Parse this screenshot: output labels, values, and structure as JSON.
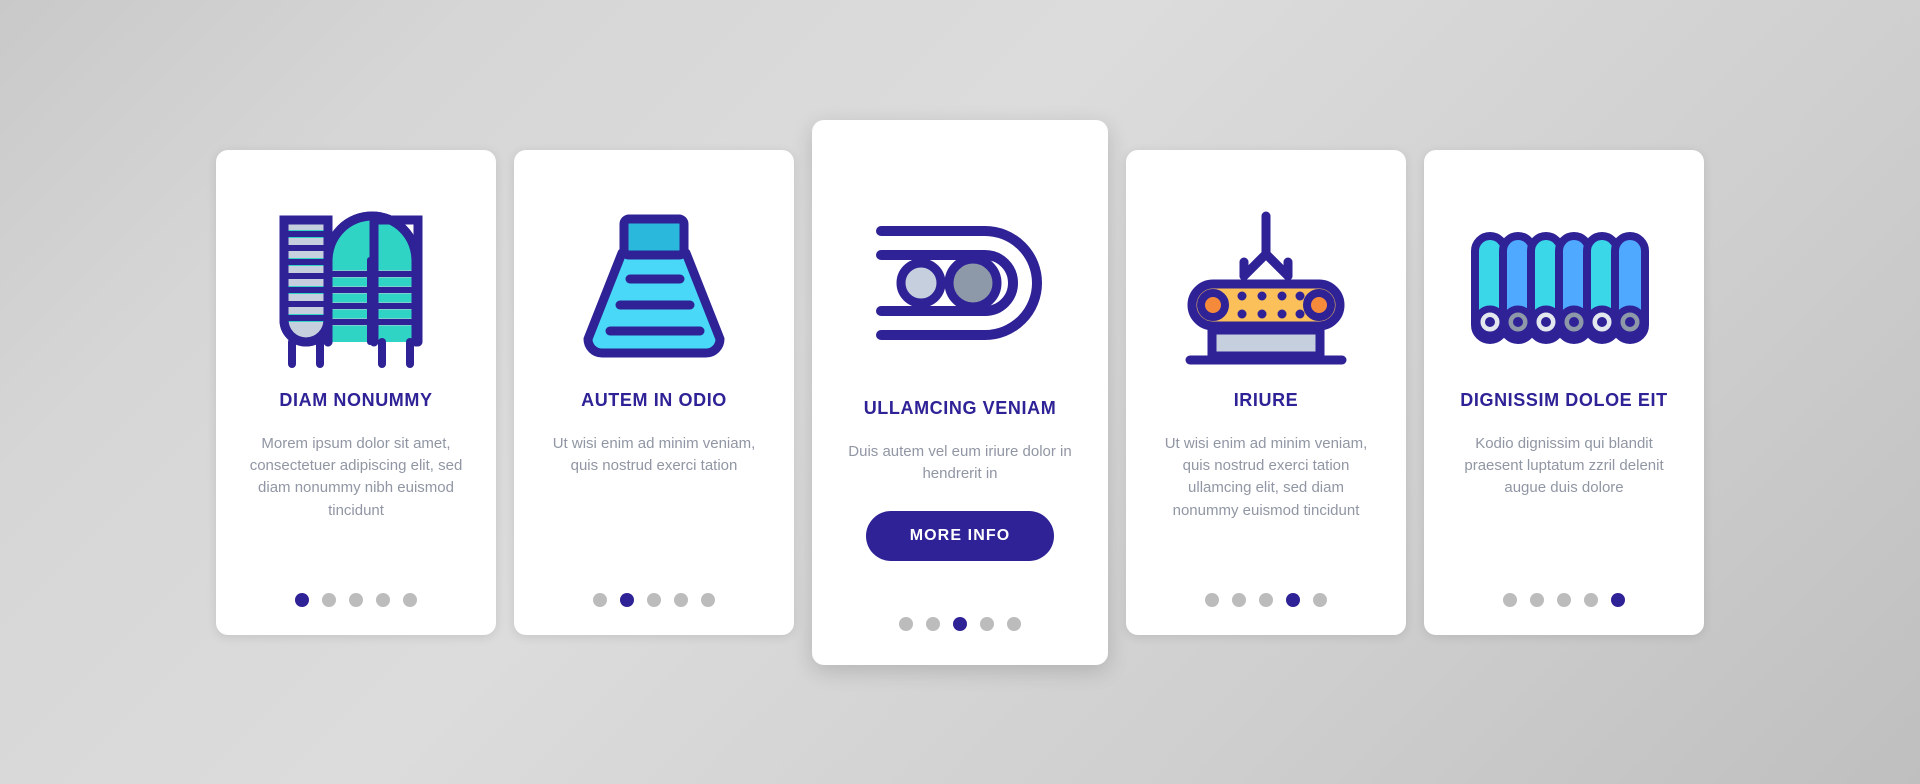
{
  "palette": {
    "indigo": "#2e2296",
    "cyan": "#3ad7e8",
    "teal": "#2fd4c4",
    "light_blue": "#4ea9ff",
    "sky": "#36c8ef",
    "orange": "#fbc05a",
    "orange_dot": "#f58a3a",
    "grey_light": "#c6cfdd",
    "grey_mid": "#8d98a8",
    "body_text": "#9096a3",
    "dot_inactive": "#bcbcbc",
    "card_bg": "#ffffff",
    "page_bg": "#d0d0d0"
  },
  "dots": {
    "count": 5
  },
  "cards": [
    {
      "icon_name": "coiled-heating-element-icon",
      "title": "DIAM NONUMMY",
      "body": "Morem ipsum dolor sit amet, consectetuer adipiscing elit, sed diam nonummy nibh euismod tincidunt",
      "active_dot": 0,
      "featured": false
    },
    {
      "icon_name": "hopper-funnel-icon",
      "title": "AUTEM IN ODIO",
      "body": "Ut wisi enim ad minim veniam, quis nostrud exerci tation",
      "active_dot": 1,
      "featured": false
    },
    {
      "icon_name": "conveyor-belt-loop-icon",
      "title": "ULLAMCING VENIAM",
      "body": "Duis autem vel eum iriure dolor in hendrerit in",
      "button_label": "MORE INFO",
      "active_dot": 2,
      "featured": true
    },
    {
      "icon_name": "robotic-claw-conveyor-icon",
      "title": "IRIURE",
      "body": "Ut wisi enim ad minim veniam, quis nostrud exerci tation ullamcing elit, sed diam nonummy euismod tincidunt",
      "active_dot": 3,
      "featured": false
    },
    {
      "icon_name": "roller-bars-icon",
      "title": "DIGNISSIM DOLOE EIT",
      "body": "Kodio dignissim qui blandit praesent luptatum zzril delenit augue duis dolore",
      "active_dot": 4,
      "featured": false
    }
  ]
}
